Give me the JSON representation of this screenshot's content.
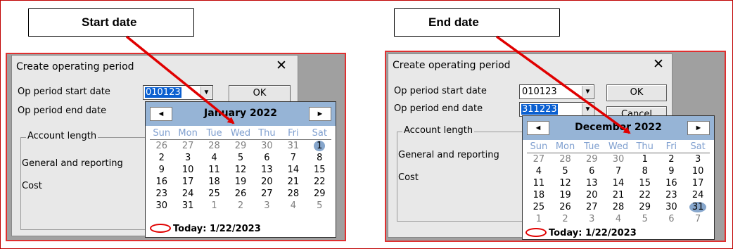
{
  "callouts": {
    "start": "Start date",
    "end": "End date"
  },
  "weekdays": [
    "Sun",
    "Mon",
    "Tue",
    "Wed",
    "Thu",
    "Fri",
    "Sat"
  ],
  "left": {
    "dialog": {
      "title": "Create operating period",
      "close": "✕",
      "start_label": "Op period start date",
      "end_label": "Op period end date",
      "start_value": "010123",
      "ok": "OK",
      "group_title": "Account length",
      "general_label": "General and reporting",
      "cost_label": "Cost"
    },
    "calendar": {
      "month": "January 2022",
      "prev": "◄",
      "next": "►",
      "today": "Today: 1/22/2023",
      "selected": 1,
      "weeks": [
        [
          [
            "26",
            1
          ],
          [
            "27",
            1
          ],
          [
            "28",
            1
          ],
          [
            "29",
            1
          ],
          [
            "30",
            1
          ],
          [
            "31",
            1
          ],
          [
            "1",
            2
          ]
        ],
        [
          [
            "2",
            0
          ],
          [
            "3",
            0
          ],
          [
            "4",
            0
          ],
          [
            "5",
            0
          ],
          [
            "6",
            0
          ],
          [
            "7",
            0
          ],
          [
            "8",
            0
          ]
        ],
        [
          [
            "9",
            0
          ],
          [
            "10",
            0
          ],
          [
            "11",
            0
          ],
          [
            "12",
            0
          ],
          [
            "13",
            0
          ],
          [
            "14",
            0
          ],
          [
            "15",
            0
          ]
        ],
        [
          [
            "16",
            0
          ],
          [
            "17",
            0
          ],
          [
            "18",
            0
          ],
          [
            "19",
            0
          ],
          [
            "20",
            0
          ],
          [
            "21",
            0
          ],
          [
            "22",
            0
          ]
        ],
        [
          [
            "23",
            0
          ],
          [
            "24",
            0
          ],
          [
            "25",
            0
          ],
          [
            "26",
            0
          ],
          [
            "27",
            0
          ],
          [
            "28",
            0
          ],
          [
            "29",
            0
          ]
        ],
        [
          [
            "30",
            0
          ],
          [
            "31",
            0
          ],
          [
            "1",
            1
          ],
          [
            "2",
            1
          ],
          [
            "3",
            1
          ],
          [
            "4",
            1
          ],
          [
            "5",
            1
          ]
        ]
      ]
    }
  },
  "right": {
    "dialog": {
      "title": "Create operating period",
      "close": "✕",
      "start_label": "Op period start date",
      "end_label": "Op period end date",
      "start_value": "010123",
      "end_value": "311223",
      "ok": "OK",
      "cancel": "Cancel",
      "group_title": "Account length",
      "general_label": "General and reporting",
      "cost_label": "Cost"
    },
    "calendar": {
      "month": "December 2022",
      "prev": "◄",
      "next": "►",
      "today": "Today: 1/22/2023",
      "weeks": [
        [
          [
            "27",
            1
          ],
          [
            "28",
            1
          ],
          [
            "29",
            1
          ],
          [
            "30",
            1
          ],
          [
            "1",
            0
          ],
          [
            "2",
            0
          ],
          [
            "3",
            0
          ]
        ],
        [
          [
            "4",
            0
          ],
          [
            "5",
            0
          ],
          [
            "6",
            0
          ],
          [
            "7",
            0
          ],
          [
            "8",
            0
          ],
          [
            "9",
            0
          ],
          [
            "10",
            0
          ]
        ],
        [
          [
            "11",
            0
          ],
          [
            "12",
            0
          ],
          [
            "13",
            0
          ],
          [
            "14",
            0
          ],
          [
            "15",
            0
          ],
          [
            "16",
            0
          ],
          [
            "17",
            0
          ]
        ],
        [
          [
            "18",
            0
          ],
          [
            "19",
            0
          ],
          [
            "20",
            0
          ],
          [
            "21",
            0
          ],
          [
            "22",
            0
          ],
          [
            "23",
            0
          ],
          [
            "24",
            0
          ]
        ],
        [
          [
            "25",
            0
          ],
          [
            "26",
            0
          ],
          [
            "27",
            0
          ],
          [
            "28",
            0
          ],
          [
            "29",
            0
          ],
          [
            "30",
            0
          ],
          [
            "31",
            2
          ]
        ],
        [
          [
            "1",
            1
          ],
          [
            "2",
            1
          ],
          [
            "3",
            1
          ],
          [
            "4",
            1
          ],
          [
            "5",
            1
          ],
          [
            "6",
            1
          ],
          [
            "7",
            1
          ]
        ]
      ]
    }
  },
  "colors": {
    "arrow": "#e00000",
    "border": "#c00000",
    "calendar_header": "#96b4d6",
    "selection": "#0a5fd0"
  }
}
